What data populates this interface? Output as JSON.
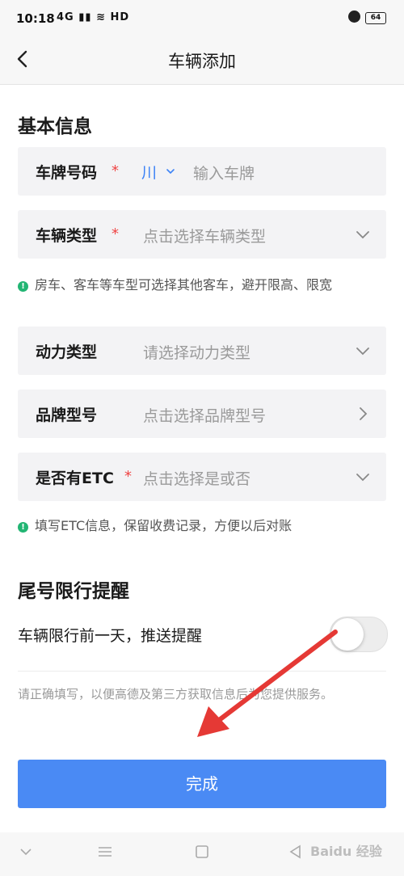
{
  "status_bar": {
    "time": "10:18",
    "network": "4G",
    "hd": "HD",
    "battery": "64"
  },
  "nav": {
    "title": "车辆添加"
  },
  "basic_info": {
    "section_title": "基本信息",
    "plate": {
      "label": "车牌号码",
      "required": "*",
      "province": "川",
      "placeholder": "输入车牌"
    },
    "vehicle_type": {
      "label": "车辆类型",
      "required": "*",
      "placeholder": "点击选择车辆类型"
    },
    "vehicle_type_hint": "房车、客车等车型可选择其他客车，避开限高、限宽",
    "power_type": {
      "label": "动力类型",
      "placeholder": "请选择动力类型"
    },
    "brand_model": {
      "label": "品牌型号",
      "placeholder": "点击选择品牌型号"
    },
    "etc": {
      "label": "是否有ETC",
      "required": "*",
      "placeholder": "点击选择是或否"
    },
    "etc_hint": "填写ETC信息，保留收费记录，方便以后对账"
  },
  "restriction": {
    "section_title": "尾号限行提醒",
    "toggle_label": "车辆限行前一天，推送提醒",
    "toggle_on": false
  },
  "note": "请正确填写，以便高德及第三方获取信息后为您提供服务。",
  "done_button": "完成",
  "watermark": "Baidu 经验",
  "colors": {
    "accent": "#4a8af4",
    "required": "#ef4444",
    "hint_icon": "#22b573",
    "annotation_arrow": "#e53935"
  }
}
